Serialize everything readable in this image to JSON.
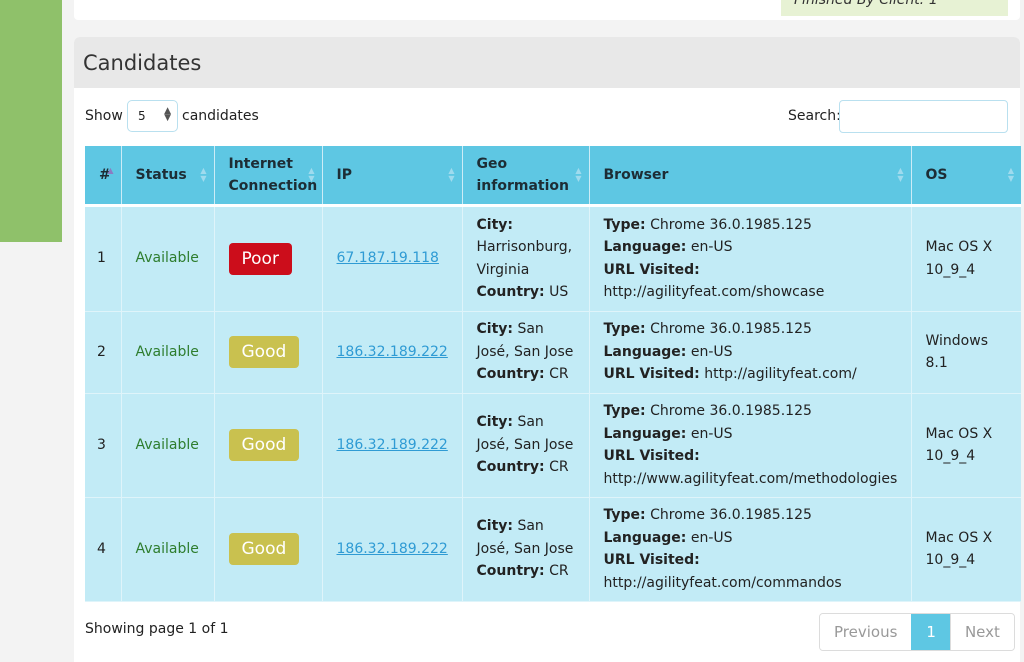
{
  "top_status": {
    "text": "Finished By Client: 1"
  },
  "panel": {
    "title": "Candidates"
  },
  "controls": {
    "show_label": "Show",
    "page_length": "5",
    "candidates_label": "candidates",
    "search_label": "Search:",
    "search_value": ""
  },
  "table": {
    "headers": [
      "#",
      "Status",
      "Internet Connection",
      "IP",
      "Geo information",
      "Browser",
      "OS"
    ],
    "rows": [
      {
        "num": "1",
        "status": "Available",
        "connection": "Poor",
        "ip": "67.187.19.118",
        "geo_city_label": "City:",
        "geo_city": "Harrisonburg, Virginia",
        "geo_country_label": "Country:",
        "geo_country": "US",
        "type_label": "Type:",
        "type": "Chrome 36.0.1985.125",
        "lang_label": "Language:",
        "lang": "en-US",
        "url_label": "URL Visited:",
        "url": "http://agilityfeat.com/showcase",
        "os": "Mac OS X 10_9_4"
      },
      {
        "num": "2",
        "status": "Available",
        "connection": "Good",
        "ip": "186.32.189.222",
        "geo_city_label": "City:",
        "geo_city": "San José, San Jose",
        "geo_country_label": "Country:",
        "geo_country": "CR",
        "type_label": "Type:",
        "type": "Chrome 36.0.1985.125",
        "lang_label": "Language:",
        "lang": "en-US",
        "url_label": "URL Visited:",
        "url": "http://agilityfeat.com/",
        "os": "Windows 8.1"
      },
      {
        "num": "3",
        "status": "Available",
        "connection": "Good",
        "ip": "186.32.189.222",
        "geo_city_label": "City:",
        "geo_city": "San José, San Jose",
        "geo_country_label": "Country:",
        "geo_country": "CR",
        "type_label": "Type:",
        "type": "Chrome 36.0.1985.125",
        "lang_label": "Language:",
        "lang": "en-US",
        "url_label": "URL Visited:",
        "url": "http://www.agilityfeat.com/methodologies",
        "os": "Mac OS X 10_9_4"
      },
      {
        "num": "4",
        "status": "Available",
        "connection": "Good",
        "ip": "186.32.189.222",
        "geo_city_label": "City:",
        "geo_city": "San José, San Jose",
        "geo_country_label": "Country:",
        "geo_country": "CR",
        "type_label": "Type:",
        "type": "Chrome 36.0.1985.125",
        "lang_label": "Language:",
        "lang": "en-US",
        "url_label": "URL Visited:",
        "url": "http://agilityfeat.com/commandos",
        "os": "Mac OS X 10_9_4"
      }
    ]
  },
  "footer": {
    "info": "Showing page 1 of 1",
    "prev": "Previous",
    "current": "1",
    "next": "Next"
  },
  "colors": {
    "accent": "#5ec7e3",
    "row_bg": "#c2ebf6",
    "poor": "#cc0d1b",
    "good": "#c9c14f",
    "available": "#2e7d2e",
    "sidebar": "#8fc16a"
  }
}
